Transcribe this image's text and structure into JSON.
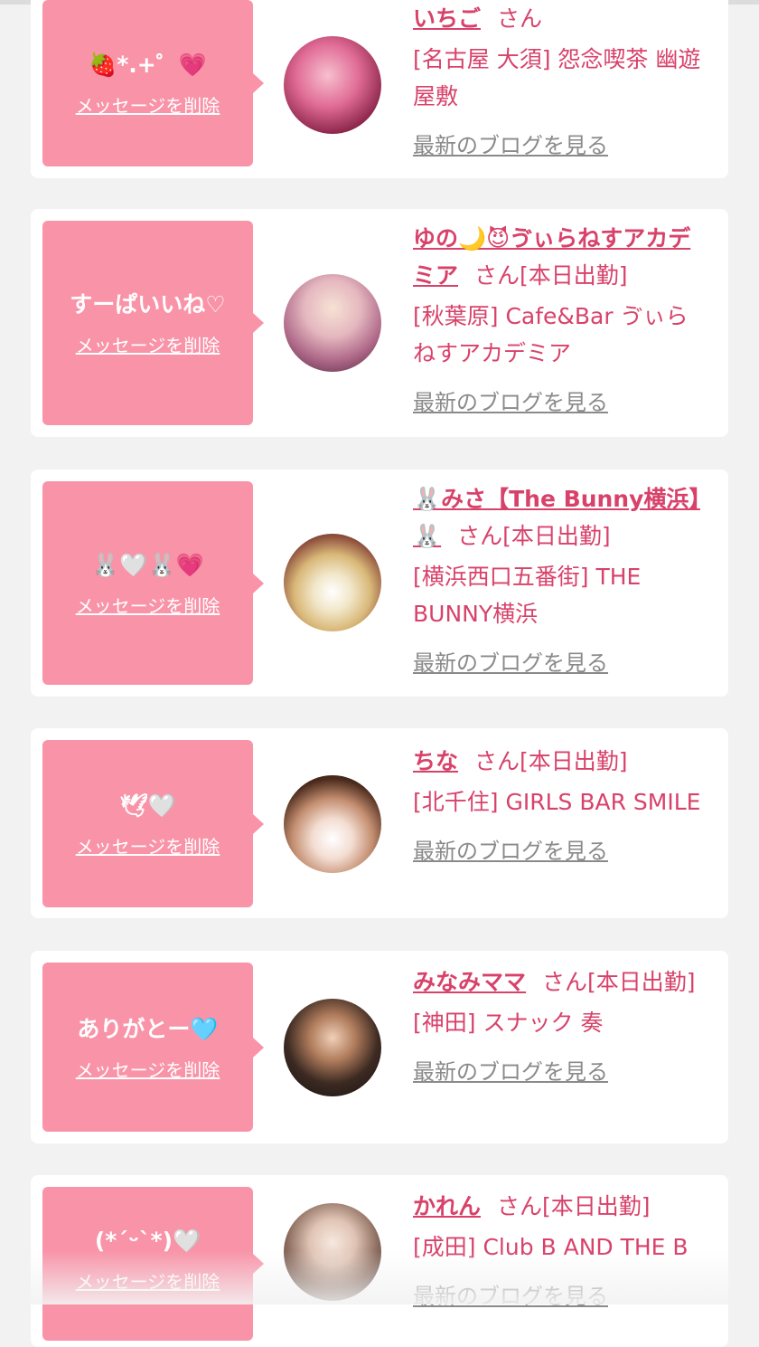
{
  "delete_label": "メッセージを削除",
  "honorific": "さん",
  "blog_label": "最新のブログを見る",
  "colors": {
    "bubble": "#f993a8",
    "accent": "#d8426a",
    "blog_link": "#8a8a8a",
    "background": "#f2f2f2"
  },
  "cards": [
    {
      "message": "🍓*.+゜💗",
      "name": "いちご",
      "status": "",
      "shop": "[名古屋 大須] 怨念喫茶 幽遊屋敷"
    },
    {
      "message": "すーぱいいね♡",
      "name": "ゆの🌙😈ゔぃらねすアカデミア",
      "status": "[本日出勤]",
      "shop": "[秋葉原] Cafe&Bar ゔぃらねすアカデミア"
    },
    {
      "message": "🐰🤍🐰💗",
      "name": "🐰みさ【The Bunny横浜】🐰",
      "status": "[本日出勤]",
      "shop": "[横浜西口五番街] THE BUNNY横浜"
    },
    {
      "message": "🕊🤍",
      "name": "ちな",
      "status": "[本日出勤]",
      "shop": "[北千住] GIRLS BAR SMILE"
    },
    {
      "message": "ありがとー🩵",
      "name": "みなみママ",
      "status": "[本日出勤]",
      "shop": "[神田] スナック 奏"
    },
    {
      "message": "(*ˊᵕˋ*)🤍",
      "name": "かれん",
      "status": "[本日出勤]",
      "shop": "[成田] Club B AND THE B"
    }
  ]
}
